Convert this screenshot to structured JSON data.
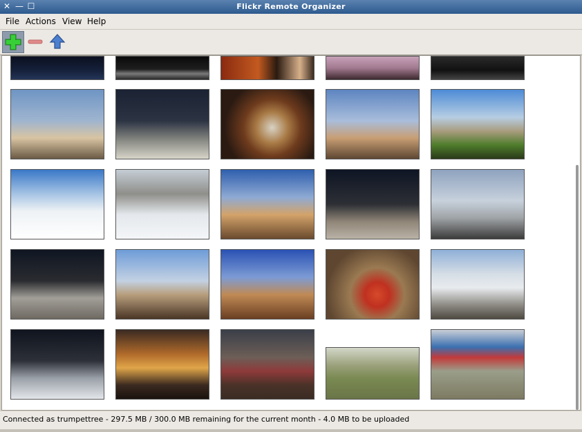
{
  "window": {
    "title": "Flickr Remote Organizer",
    "controls": {
      "close": "✕",
      "minimize": "—",
      "maximize": "☐"
    }
  },
  "menu": [
    "File",
    "Actions",
    "View",
    "Help"
  ],
  "toolbar": {
    "buttons": [
      {
        "name": "add-icon",
        "active": true
      },
      {
        "name": "remove-icon",
        "active": false
      },
      {
        "name": "upload-icon",
        "active": false
      }
    ]
  },
  "photos": {
    "partial_row": [
      {
        "bg": "linear-gradient(#0b1020 0%,#15203a 60%,#243558 100%)"
      },
      {
        "bg": "linear-gradient(#0a0a0a 0%,#1e1e1e 55%,#7a7a7a 75%,#2a2a2a 100%)"
      },
      {
        "bg": "linear-gradient(90deg,#8a2a10 0%,#c35a20 40%,#2a1a10 60%,#d7b08a 85%,#3a2a20 100%)"
      },
      {
        "bg": "linear-gradient(#c7a1b8 0%,#a27a90 50%,#3e2a2f 100%)"
      },
      {
        "bg": "linear-gradient(#2a2a2a 0%,#111 60%,#444 100%)"
      }
    ],
    "rows": [
      [
        {
          "bg": "linear-gradient(#6f95c4 0%,#9fb5cf 45%,#d8c4a2 70%,#6b5a45 100%)"
        },
        {
          "bg": "linear-gradient(#1a2233 0%,#2c3443 45%,#7d7f7b 70%,#d8d5c9 100%)"
        },
        {
          "bg": "radial-gradient(circle at 55% 55%,#d8d2c4 0%,#a87a45 25%,#6e3b1d 45%,#2a1a12 75%)"
        },
        {
          "bg": "linear-gradient(#5d85c0 0%,#a9bddb 45%,#c89e74 70%,#5e4733 100%)"
        },
        {
          "bg": "linear-gradient(#4d8bd6 0%,#b6cde3 40%,#a99c7e 60%,#4f7d2c 80%,#2a3a1a 100%)"
        }
      ],
      [
        {
          "bg": "linear-gradient(#3a78c8 0%,#a6c4e4 35%,#eef2f5 60%,#ffffff 100%)"
        },
        {
          "bg": "linear-gradient(#c5cdd5 0%,#8f8f8a 35%,#e4e8ec 65%,#f4f6f8 100%)"
        },
        {
          "bg": "linear-gradient(#2f5fae 0%,#8faad3 40%,#d3a36a 65%,#6a4a2e 100%)"
        },
        {
          "bg": "linear-gradient(#0e1524 0%,#2d2f35 50%,#8f8577 75%,#b9b2a6 100%)"
        },
        {
          "bg": "linear-gradient(#8fa3bf 0%,#c7d1dc 45%,#9fa3a6 70%,#3b3b3b 100%)"
        }
      ],
      [
        {
          "bg": "linear-gradient(#0f1622 0%,#2a2b30 45%,#a29f98 70%,#6e6a62 100%)"
        },
        {
          "bg": "linear-gradient(#6e9cd8 0%,#c3d1e3 45%,#b79e7c 65%,#4a3626 100%)"
        },
        {
          "bg": "linear-gradient(#2a52b4 0%,#7d9bd4 40%,#c08a55 65%,#6a3f22 100%)"
        },
        {
          "bg": "radial-gradient(circle at 55% 65%,#d64a2a 0%,#c03020 18%,#9a7a52 40%,#5e4630 75%)"
        },
        {
          "bg": "linear-gradient(#8fb0d8 0%,#d5dde5 35%,#e8ebee 55%,#8d8b84 80%,#4e4a42 100%)"
        }
      ],
      [
        {
          "bg": "linear-gradient(#0f141e 0%,#2d3038 45%,#9aa0a8 70%,#e3e6ea 100%)"
        },
        {
          "bg": "linear-gradient(#3a2a22 0%,#b06a2a 35%,#e0a64a 55%,#3b2a20 80%,#1a120e 100%)"
        },
        {
          "bg": "linear-gradient(#3a3f49 0%,#6d5e57 40%,#8e3a3a 60%,#4a3228 80%,#3b2c24 100%)"
        },
        {
          "bg": "linear-gradient(#d2d7c8 0%,#9aa07a 35%,#7a8a52 60%,#6a7548 100%)"
        },
        {
          "bg": "linear-gradient(#c9ced6 0%,#3a6fb0 25%,#c23a3a 40%,#9a9e8a 60%,#7d7a62 100%)"
        }
      ]
    ]
  },
  "status": "Connected as trumpettree - 297.5 MB / 300.0 MB remaining for the current month - 4.0 MB to be uploaded"
}
